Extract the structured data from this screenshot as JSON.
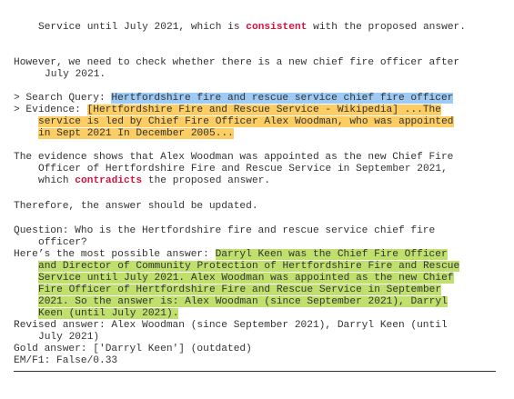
{
  "p1": {
    "pre": "Service until July 2021, which is ",
    "keyword": "consistent",
    "post": " with the proposed answer."
  },
  "p2": {
    "l1": "However, we need to check whether there is a new chief fire officer after",
    "l2": "July 2021."
  },
  "search": {
    "prefix": "> Search Query: ",
    "query": "Hertfordshire fire and rescue service chief fire officer"
  },
  "evidence": {
    "prefix": "> Evidence: ",
    "l1": "[Hertfordshire Fire and Rescue Service - Wikipedia] ...The",
    "l2": "service is led by Chief Fire Officer Alex Woodman, who was appointed",
    "l3": "in Sept 2021 In December 2005..."
  },
  "p3": {
    "l1": "The evidence shows that Alex Woodman was appointed as the new Chief Fire",
    "l2": "Officer of Hertfordshire Fire and Rescue Service in September 2021,",
    "l3_pre": "which ",
    "l3_keyword": "contradicts",
    "l3_post": " the proposed answer."
  },
  "p4": "Therefore, the answer should be updated.",
  "question": {
    "l1": "Question: Who is the Hertfordshire fire and rescue service chief fire",
    "l2": "officer?"
  },
  "answer": {
    "prefix": "Here’s the most possible answer: ",
    "l1": "Darryl Keen was the Chief Fire Officer",
    "l2": "and Director of Community Protection of Hertfordshire Fire and Rescue",
    "l3": "Service until July 2021. Alex Woodman was appointed as the new Chief",
    "l4": "Fire Officer of Hertfordshire Fire and Rescue Service in September",
    "l5": "2021. So the answer is: Alex Woodman (since September 2021), Darryl",
    "l6": "Keen (until July 2021)."
  },
  "revised": {
    "l1": "Revised answer: Alex Woodman (since September 2021), Darryl Keen (until",
    "l2": "July 2021)"
  },
  "gold": "Gold answer: ['Darryl Keen'] (outdated)",
  "emf1": "EM/F1: False/0.33",
  "colors": {
    "keyword": "#d4143c",
    "highlight_blue": "#9dcbf5",
    "highlight_orange": "#fbcd63",
    "highlight_green": "#bfe06d"
  }
}
